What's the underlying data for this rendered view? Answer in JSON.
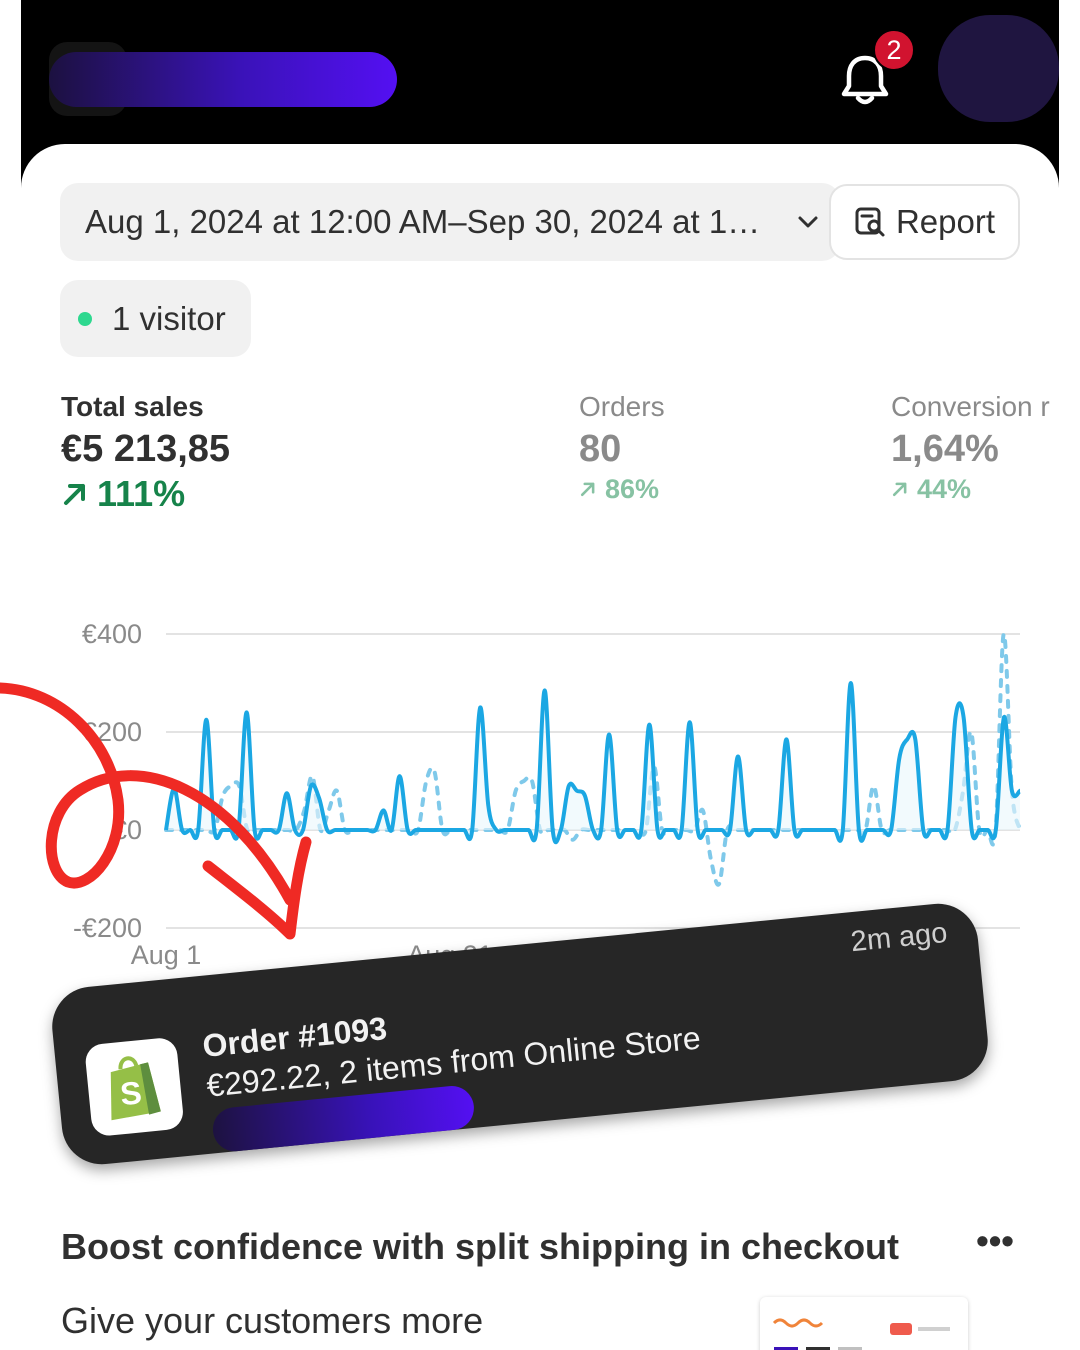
{
  "header": {
    "notification_count": "2",
    "bell_icon": "bell-icon",
    "brand_gradient": [
      "#1c1140",
      "#5410f2"
    ]
  },
  "filters": {
    "date_range": "Aug 1, 2024 at 12:00 AM–Sep 30, 2024 at 1…",
    "report_label": "Report",
    "report_icon": "report-search-icon"
  },
  "live": {
    "visitors": "1 visitor",
    "status_color": "#2ed88f"
  },
  "metrics": [
    {
      "label": "Total sales",
      "value": "€5 213,85",
      "change": "111%",
      "trend": "up"
    },
    {
      "label": "Orders",
      "value": "80",
      "change": "86%",
      "trend": "up"
    },
    {
      "label": "Conversion r",
      "value": "1,64%",
      "change": "44%",
      "trend": "up"
    }
  ],
  "chart_data": {
    "type": "line",
    "y_ticks": [
      "€400",
      "€200",
      "€0",
      "-€200"
    ],
    "ylim": [
      -200,
      400
    ],
    "x_ticks": [
      "Aug 1",
      "Aug 21"
    ],
    "grid": true,
    "series": [
      {
        "style": "solid",
        "color": "#1ba7e3",
        "values": [
          0,
          85,
          0,
          0,
          0,
          225,
          0,
          0,
          0,
          0,
          240,
          0,
          0,
          0,
          0,
          75,
          0,
          0,
          90,
          65,
          0,
          0,
          0,
          0,
          0,
          0,
          0,
          40,
          0,
          110,
          0,
          0,
          0,
          0,
          0,
          0,
          0,
          0,
          0,
          250,
          50,
          0,
          0,
          0,
          0,
          0,
          0,
          285,
          0,
          0,
          90,
          80,
          70,
          0,
          0,
          195,
          0,
          0,
          0,
          0,
          215,
          0,
          0,
          0,
          0,
          220,
          0,
          0,
          0,
          0,
          0,
          150,
          0,
          0,
          0,
          0,
          0,
          185,
          0,
          0,
          0,
          0,
          0,
          0,
          0,
          300,
          0,
          0,
          0,
          0,
          0,
          145,
          185,
          185,
          0,
          0,
          0,
          0,
          230,
          230,
          0,
          0,
          0,
          0,
          230,
          80,
          80
        ]
      },
      {
        "style": "dotted",
        "color": "#7fc9ea",
        "values": [
          0,
          0,
          0,
          0,
          0,
          0,
          0,
          70,
          90,
          90,
          0,
          0,
          0,
          0,
          0,
          0,
          0,
          40,
          110,
          0,
          40,
          80,
          0,
          0,
          0,
          0,
          0,
          0,
          0,
          0,
          0,
          0,
          100,
          120,
          0,
          0,
          0,
          0,
          0,
          0,
          0,
          0,
          0,
          80,
          100,
          100,
          0,
          0,
          0,
          0,
          -20,
          0,
          0,
          0,
          0,
          0,
          0,
          0,
          0,
          0,
          130,
          0,
          0,
          0,
          0,
          0,
          40,
          -60,
          -110,
          0,
          0,
          0,
          0,
          0,
          0,
          0,
          0,
          0,
          0,
          0,
          0,
          0,
          0,
          0,
          0,
          0,
          0,
          90,
          0,
          0,
          0,
          0,
          0,
          0,
          0,
          0,
          0,
          0,
          80,
          200,
          0,
          0,
          0,
          400,
          80,
          0
        ]
      }
    ]
  },
  "toast": {
    "title": "Order #1093",
    "body": "€292.22, 2 items from Online Store",
    "time": "2m ago",
    "app_icon": "shopify-bag-icon"
  },
  "promo": {
    "title": "Boost confidence with split shipping in checkout",
    "more_label": "•••",
    "body": "Give your customers more"
  },
  "annotation": {
    "color": "#ef2a24",
    "arrow_icon": "hand-drawn-arrow-icon"
  }
}
